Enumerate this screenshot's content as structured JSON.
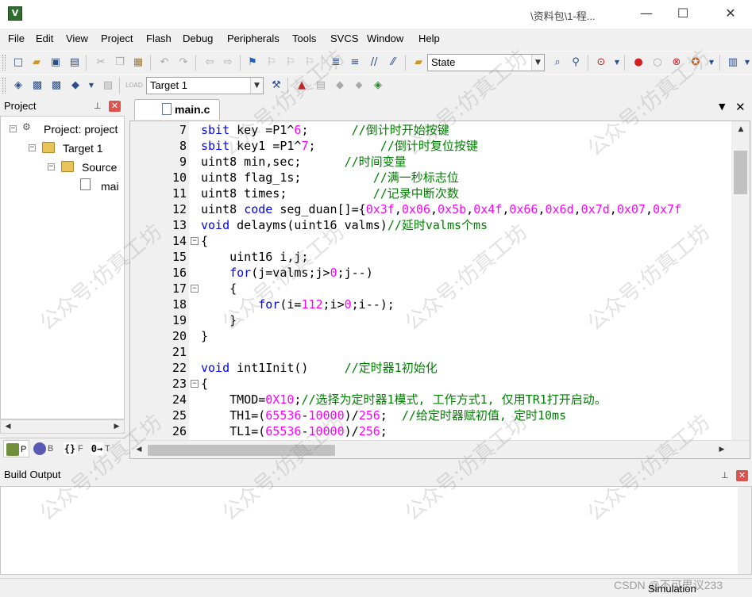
{
  "window": {
    "title": "\\资料包\\1-程...",
    "controls": {
      "minimize": "—",
      "maximize": "☐",
      "close": "✕"
    }
  },
  "menu": [
    "File",
    "Edit",
    "View",
    "Project",
    "Flash",
    "Debug",
    "Peripherals",
    "Tools",
    "SVCS",
    "Window",
    "Help"
  ],
  "toolbar": {
    "state_label": "State",
    "target_select": "Target 1"
  },
  "project_pane": {
    "title": "Project",
    "tree": {
      "root": "Project: project",
      "target": "Target 1",
      "group": "Source",
      "file": "mai"
    },
    "tabs": [
      "P",
      "B",
      "F",
      "T"
    ],
    "tab_icons": [
      "project-tab-icon",
      "books-tab-icon",
      "functions-tab-icon",
      "templates-tab-icon"
    ]
  },
  "editor": {
    "tab": "main.c",
    "lines": [
      {
        "n": "7",
        "fold": "",
        "tokens": [
          {
            "c": "kw",
            "t": "sbit"
          },
          {
            "c": "pl",
            "t": " key =P1^"
          },
          {
            "c": "num",
            "t": "6"
          },
          {
            "c": "pl",
            "t": ";      "
          },
          {
            "c": "cm",
            "t": "//倒计时开始按键"
          }
        ]
      },
      {
        "n": "8",
        "fold": "",
        "tokens": [
          {
            "c": "kw",
            "t": "sbit"
          },
          {
            "c": "pl",
            "t": " key1 =P1^"
          },
          {
            "c": "num",
            "t": "7"
          },
          {
            "c": "pl",
            "t": ";         "
          },
          {
            "c": "cm",
            "t": "//倒计时复位按键"
          }
        ]
      },
      {
        "n": "9",
        "fold": "",
        "tokens": [
          {
            "c": "pl",
            "t": "uint8 min,sec;      "
          },
          {
            "c": "cm",
            "t": "//时间变量"
          }
        ]
      },
      {
        "n": "10",
        "fold": "",
        "tokens": [
          {
            "c": "pl",
            "t": "uint8 flag_1s;          "
          },
          {
            "c": "cm",
            "t": "//满一秒标志位"
          }
        ]
      },
      {
        "n": "11",
        "fold": "",
        "tokens": [
          {
            "c": "pl",
            "t": "uint8 times;            "
          },
          {
            "c": "cm",
            "t": "//记录中断次数"
          }
        ]
      },
      {
        "n": "12",
        "fold": "",
        "tokens": [
          {
            "c": "pl",
            "t": "uint8 "
          },
          {
            "c": "kw",
            "t": "code"
          },
          {
            "c": "pl",
            "t": " seg_duan[]={"
          },
          {
            "c": "num",
            "t": "0x3f"
          },
          {
            "c": "pl",
            "t": ","
          },
          {
            "c": "num",
            "t": "0x06"
          },
          {
            "c": "pl",
            "t": ","
          },
          {
            "c": "num",
            "t": "0x5b"
          },
          {
            "c": "pl",
            "t": ","
          },
          {
            "c": "num",
            "t": "0x4f"
          },
          {
            "c": "pl",
            "t": ","
          },
          {
            "c": "num",
            "t": "0x66"
          },
          {
            "c": "pl",
            "t": ","
          },
          {
            "c": "num",
            "t": "0x6d"
          },
          {
            "c": "pl",
            "t": ","
          },
          {
            "c": "num",
            "t": "0x7d"
          },
          {
            "c": "pl",
            "t": ","
          },
          {
            "c": "num",
            "t": "0x07"
          },
          {
            "c": "pl",
            "t": ","
          },
          {
            "c": "num",
            "t": "0x7f"
          }
        ]
      },
      {
        "n": "13",
        "fold": "",
        "tokens": [
          {
            "c": "kw",
            "t": "void"
          },
          {
            "c": "pl",
            "t": " delayms(uint16 valms)"
          },
          {
            "c": "cm",
            "t": "//延时valms个ms"
          }
        ]
      },
      {
        "n": "14",
        "fold": "−",
        "tokens": [
          {
            "c": "pl",
            "t": "{"
          }
        ]
      },
      {
        "n": "15",
        "fold": "",
        "tokens": [
          {
            "c": "pl",
            "t": "    uint16 i,j;"
          }
        ]
      },
      {
        "n": "16",
        "fold": "",
        "tokens": [
          {
            "c": "pl",
            "t": "    "
          },
          {
            "c": "kw",
            "t": "for"
          },
          {
            "c": "pl",
            "t": "(j=valms;j>"
          },
          {
            "c": "num",
            "t": "0"
          },
          {
            "c": "pl",
            "t": ";j--)"
          }
        ]
      },
      {
        "n": "17",
        "fold": "−",
        "tokens": [
          {
            "c": "pl",
            "t": "    {"
          }
        ]
      },
      {
        "n": "18",
        "fold": "",
        "tokens": [
          {
            "c": "pl",
            "t": "        "
          },
          {
            "c": "kw",
            "t": "for"
          },
          {
            "c": "pl",
            "t": "(i="
          },
          {
            "c": "num",
            "t": "112"
          },
          {
            "c": "pl",
            "t": ";i>"
          },
          {
            "c": "num",
            "t": "0"
          },
          {
            "c": "pl",
            "t": ";i--);"
          }
        ]
      },
      {
        "n": "19",
        "fold": "",
        "tokens": [
          {
            "c": "pl",
            "t": "    }"
          }
        ]
      },
      {
        "n": "20",
        "fold": "",
        "tokens": [
          {
            "c": "pl",
            "t": "}"
          }
        ]
      },
      {
        "n": "21",
        "fold": "",
        "tokens": []
      },
      {
        "n": "22",
        "fold": "",
        "tokens": [
          {
            "c": "kw",
            "t": "void"
          },
          {
            "c": "pl",
            "t": " int1Init()     "
          },
          {
            "c": "cm",
            "t": "//定时器1初始化"
          }
        ]
      },
      {
        "n": "23",
        "fold": "−",
        "tokens": [
          {
            "c": "pl",
            "t": "{"
          }
        ]
      },
      {
        "n": "24",
        "fold": "",
        "tokens": [
          {
            "c": "pl",
            "t": "    TMOD="
          },
          {
            "c": "num",
            "t": "0X10"
          },
          {
            "c": "pl",
            "t": ";"
          },
          {
            "c": "cm",
            "t": "//选择为定时器1模式, 工作方式1, 仅用TR1打开启动。"
          }
        ]
      },
      {
        "n": "25",
        "fold": "",
        "tokens": [
          {
            "c": "pl",
            "t": "    TH1=("
          },
          {
            "c": "num",
            "t": "65536"
          },
          {
            "c": "pl",
            "t": "-"
          },
          {
            "c": "num",
            "t": "10000"
          },
          {
            "c": "pl",
            "t": ")/"
          },
          {
            "c": "num",
            "t": "256"
          },
          {
            "c": "pl",
            "t": ";  "
          },
          {
            "c": "cm",
            "t": "//给定时器赋初值, 定时10ms"
          }
        ]
      },
      {
        "n": "26",
        "fold": "",
        "tokens": [
          {
            "c": "pl",
            "t": "    TL1=("
          },
          {
            "c": "num",
            "t": "65536"
          },
          {
            "c": "pl",
            "t": "-"
          },
          {
            "c": "num",
            "t": "10000"
          },
          {
            "c": "pl",
            "t": ")/"
          },
          {
            "c": "num",
            "t": "256"
          },
          {
            "c": "pl",
            "t": ";"
          }
        ]
      }
    ]
  },
  "build_output": {
    "title": "Build Output"
  },
  "status_bar": {
    "mode": "Simulation"
  },
  "watermark": {
    "text": "公众号:仿真工坊",
    "credit": "CSDN @不可思议233"
  },
  "colors": {
    "keyword": "#0000ff",
    "number": "#ff00ff",
    "comment": "#008000",
    "accent_close": "#d9534f"
  }
}
